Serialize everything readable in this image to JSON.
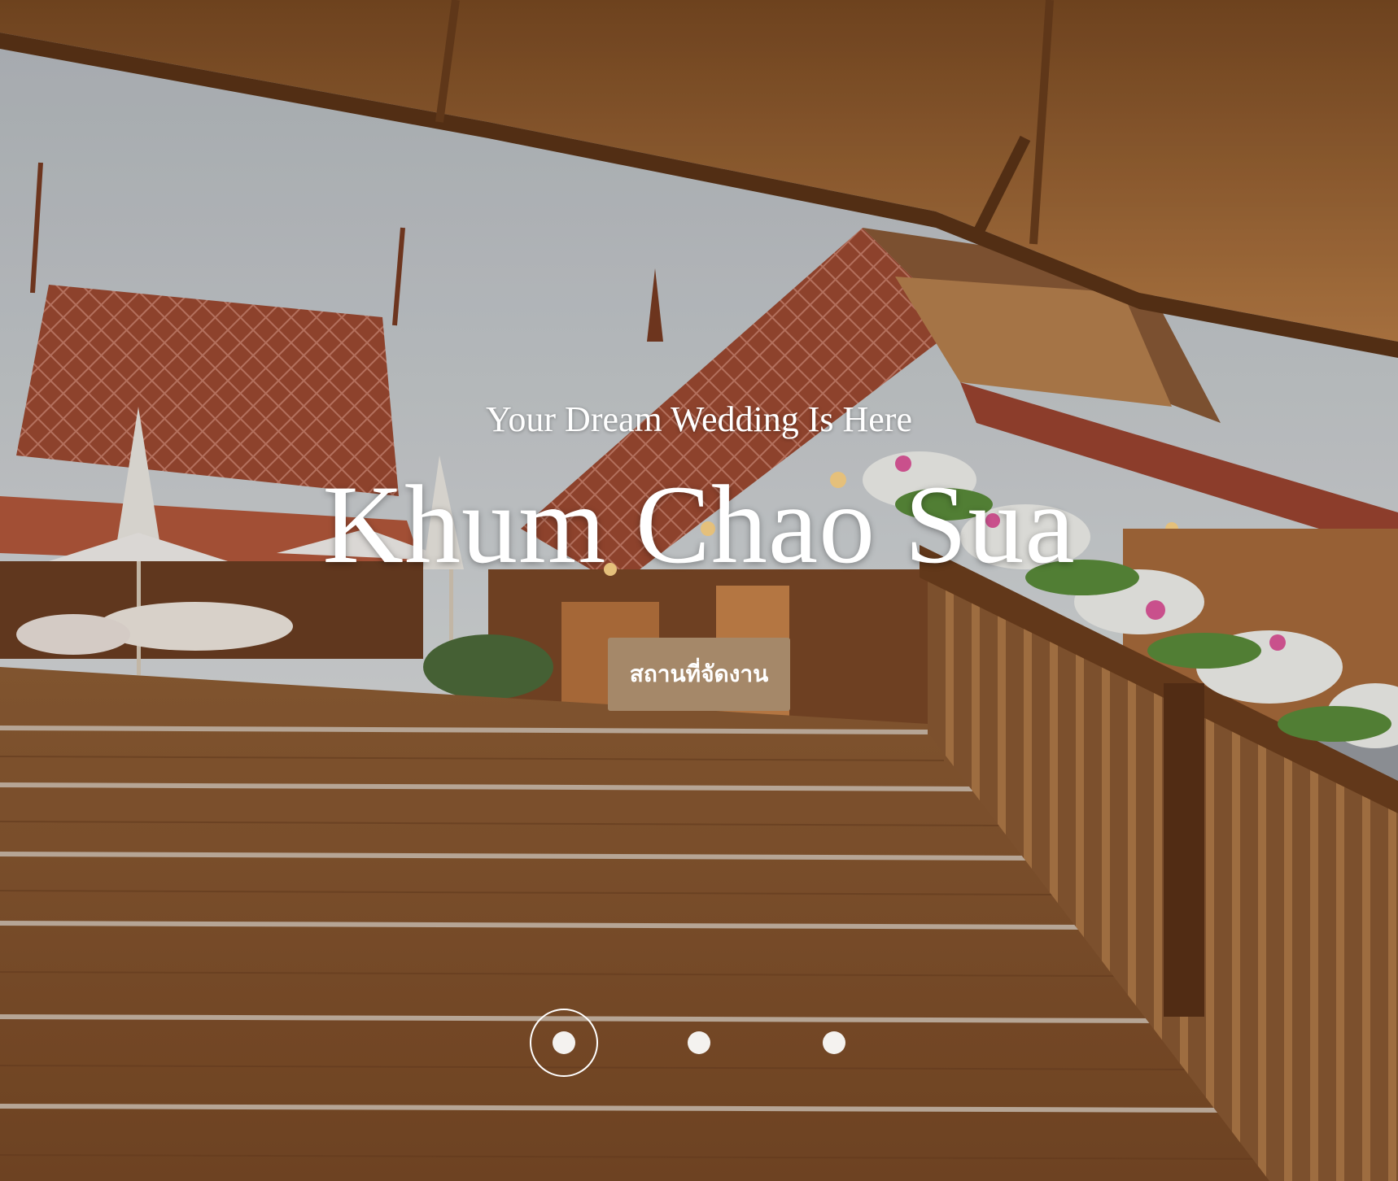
{
  "hero": {
    "tagline": "Your Dream Wedding Is Here",
    "title": "Khum Chao Sua",
    "cta_label": "สถานที่จัดงาน",
    "slides": [
      {
        "active": true
      },
      {
        "active": false
      },
      {
        "active": false
      }
    ]
  },
  "colors": {
    "cta_background": "#a58869",
    "text": "#ffffff"
  },
  "icons": [
    "slide-dot-icon"
  ]
}
